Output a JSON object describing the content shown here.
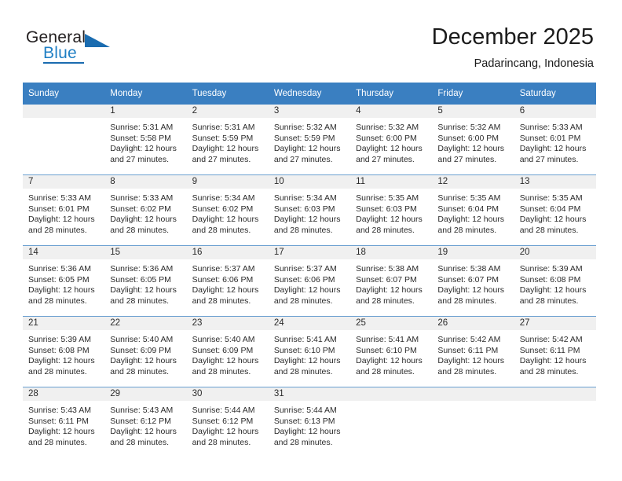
{
  "brand": {
    "name_top": "General",
    "name_bottom": "Blue",
    "accent_color": "#1a6cb0"
  },
  "header": {
    "title": "December 2025",
    "location": "Padarincang, Indonesia"
  },
  "theme": {
    "header_row_bg": "#3a7fc1",
    "daynum_strip_bg": "#f0f0f0",
    "row_divider": "#6a9fd0",
    "text": "#2a2a2a"
  },
  "weekday_headers": [
    "Sunday",
    "Monday",
    "Tuesday",
    "Wednesday",
    "Thursday",
    "Friday",
    "Saturday"
  ],
  "weeks": [
    [
      {
        "day": "",
        "sunrise": "",
        "sunset": "",
        "daylight_line1": "",
        "daylight_line2": ""
      },
      {
        "day": "1",
        "sunrise": "Sunrise: 5:31 AM",
        "sunset": "Sunset: 5:58 PM",
        "daylight_line1": "Daylight: 12 hours",
        "daylight_line2": "and 27 minutes."
      },
      {
        "day": "2",
        "sunrise": "Sunrise: 5:31 AM",
        "sunset": "Sunset: 5:59 PM",
        "daylight_line1": "Daylight: 12 hours",
        "daylight_line2": "and 27 minutes."
      },
      {
        "day": "3",
        "sunrise": "Sunrise: 5:32 AM",
        "sunset": "Sunset: 5:59 PM",
        "daylight_line1": "Daylight: 12 hours",
        "daylight_line2": "and 27 minutes."
      },
      {
        "day": "4",
        "sunrise": "Sunrise: 5:32 AM",
        "sunset": "Sunset: 6:00 PM",
        "daylight_line1": "Daylight: 12 hours",
        "daylight_line2": "and 27 minutes."
      },
      {
        "day": "5",
        "sunrise": "Sunrise: 5:32 AM",
        "sunset": "Sunset: 6:00 PM",
        "daylight_line1": "Daylight: 12 hours",
        "daylight_line2": "and 27 minutes."
      },
      {
        "day": "6",
        "sunrise": "Sunrise: 5:33 AM",
        "sunset": "Sunset: 6:01 PM",
        "daylight_line1": "Daylight: 12 hours",
        "daylight_line2": "and 27 minutes."
      }
    ],
    [
      {
        "day": "7",
        "sunrise": "Sunrise: 5:33 AM",
        "sunset": "Sunset: 6:01 PM",
        "daylight_line1": "Daylight: 12 hours",
        "daylight_line2": "and 28 minutes."
      },
      {
        "day": "8",
        "sunrise": "Sunrise: 5:33 AM",
        "sunset": "Sunset: 6:02 PM",
        "daylight_line1": "Daylight: 12 hours",
        "daylight_line2": "and 28 minutes."
      },
      {
        "day": "9",
        "sunrise": "Sunrise: 5:34 AM",
        "sunset": "Sunset: 6:02 PM",
        "daylight_line1": "Daylight: 12 hours",
        "daylight_line2": "and 28 minutes."
      },
      {
        "day": "10",
        "sunrise": "Sunrise: 5:34 AM",
        "sunset": "Sunset: 6:03 PM",
        "daylight_line1": "Daylight: 12 hours",
        "daylight_line2": "and 28 minutes."
      },
      {
        "day": "11",
        "sunrise": "Sunrise: 5:35 AM",
        "sunset": "Sunset: 6:03 PM",
        "daylight_line1": "Daylight: 12 hours",
        "daylight_line2": "and 28 minutes."
      },
      {
        "day": "12",
        "sunrise": "Sunrise: 5:35 AM",
        "sunset": "Sunset: 6:04 PM",
        "daylight_line1": "Daylight: 12 hours",
        "daylight_line2": "and 28 minutes."
      },
      {
        "day": "13",
        "sunrise": "Sunrise: 5:35 AM",
        "sunset": "Sunset: 6:04 PM",
        "daylight_line1": "Daylight: 12 hours",
        "daylight_line2": "and 28 minutes."
      }
    ],
    [
      {
        "day": "14",
        "sunrise": "Sunrise: 5:36 AM",
        "sunset": "Sunset: 6:05 PM",
        "daylight_line1": "Daylight: 12 hours",
        "daylight_line2": "and 28 minutes."
      },
      {
        "day": "15",
        "sunrise": "Sunrise: 5:36 AM",
        "sunset": "Sunset: 6:05 PM",
        "daylight_line1": "Daylight: 12 hours",
        "daylight_line2": "and 28 minutes."
      },
      {
        "day": "16",
        "sunrise": "Sunrise: 5:37 AM",
        "sunset": "Sunset: 6:06 PM",
        "daylight_line1": "Daylight: 12 hours",
        "daylight_line2": "and 28 minutes."
      },
      {
        "day": "17",
        "sunrise": "Sunrise: 5:37 AM",
        "sunset": "Sunset: 6:06 PM",
        "daylight_line1": "Daylight: 12 hours",
        "daylight_line2": "and 28 minutes."
      },
      {
        "day": "18",
        "sunrise": "Sunrise: 5:38 AM",
        "sunset": "Sunset: 6:07 PM",
        "daylight_line1": "Daylight: 12 hours",
        "daylight_line2": "and 28 minutes."
      },
      {
        "day": "19",
        "sunrise": "Sunrise: 5:38 AM",
        "sunset": "Sunset: 6:07 PM",
        "daylight_line1": "Daylight: 12 hours",
        "daylight_line2": "and 28 minutes."
      },
      {
        "day": "20",
        "sunrise": "Sunrise: 5:39 AM",
        "sunset": "Sunset: 6:08 PM",
        "daylight_line1": "Daylight: 12 hours",
        "daylight_line2": "and 28 minutes."
      }
    ],
    [
      {
        "day": "21",
        "sunrise": "Sunrise: 5:39 AM",
        "sunset": "Sunset: 6:08 PM",
        "daylight_line1": "Daylight: 12 hours",
        "daylight_line2": "and 28 minutes."
      },
      {
        "day": "22",
        "sunrise": "Sunrise: 5:40 AM",
        "sunset": "Sunset: 6:09 PM",
        "daylight_line1": "Daylight: 12 hours",
        "daylight_line2": "and 28 minutes."
      },
      {
        "day": "23",
        "sunrise": "Sunrise: 5:40 AM",
        "sunset": "Sunset: 6:09 PM",
        "daylight_line1": "Daylight: 12 hours",
        "daylight_line2": "and 28 minutes."
      },
      {
        "day": "24",
        "sunrise": "Sunrise: 5:41 AM",
        "sunset": "Sunset: 6:10 PM",
        "daylight_line1": "Daylight: 12 hours",
        "daylight_line2": "and 28 minutes."
      },
      {
        "day": "25",
        "sunrise": "Sunrise: 5:41 AM",
        "sunset": "Sunset: 6:10 PM",
        "daylight_line1": "Daylight: 12 hours",
        "daylight_line2": "and 28 minutes."
      },
      {
        "day": "26",
        "sunrise": "Sunrise: 5:42 AM",
        "sunset": "Sunset: 6:11 PM",
        "daylight_line1": "Daylight: 12 hours",
        "daylight_line2": "and 28 minutes."
      },
      {
        "day": "27",
        "sunrise": "Sunrise: 5:42 AM",
        "sunset": "Sunset: 6:11 PM",
        "daylight_line1": "Daylight: 12 hours",
        "daylight_line2": "and 28 minutes."
      }
    ],
    [
      {
        "day": "28",
        "sunrise": "Sunrise: 5:43 AM",
        "sunset": "Sunset: 6:11 PM",
        "daylight_line1": "Daylight: 12 hours",
        "daylight_line2": "and 28 minutes."
      },
      {
        "day": "29",
        "sunrise": "Sunrise: 5:43 AM",
        "sunset": "Sunset: 6:12 PM",
        "daylight_line1": "Daylight: 12 hours",
        "daylight_line2": "and 28 minutes."
      },
      {
        "day": "30",
        "sunrise": "Sunrise: 5:44 AM",
        "sunset": "Sunset: 6:12 PM",
        "daylight_line1": "Daylight: 12 hours",
        "daylight_line2": "and 28 minutes."
      },
      {
        "day": "31",
        "sunrise": "Sunrise: 5:44 AM",
        "sunset": "Sunset: 6:13 PM",
        "daylight_line1": "Daylight: 12 hours",
        "daylight_line2": "and 28 minutes."
      },
      {
        "day": "",
        "sunrise": "",
        "sunset": "",
        "daylight_line1": "",
        "daylight_line2": ""
      },
      {
        "day": "",
        "sunrise": "",
        "sunset": "",
        "daylight_line1": "",
        "daylight_line2": ""
      },
      {
        "day": "",
        "sunrise": "",
        "sunset": "",
        "daylight_line1": "",
        "daylight_line2": ""
      }
    ]
  ]
}
